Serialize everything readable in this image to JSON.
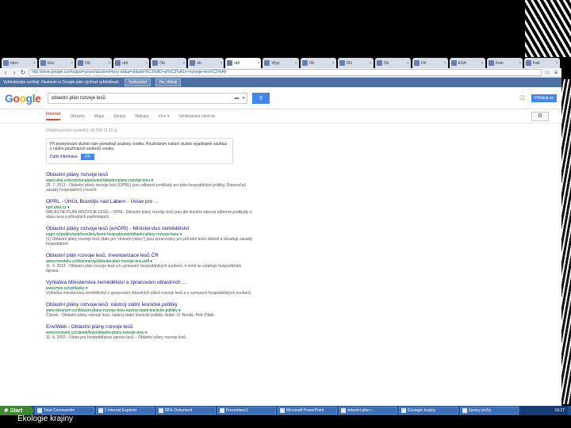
{
  "browser": {
    "tabs": [
      {
        "label": "Iden"
      },
      {
        "label": "Eko"
      },
      {
        "label": "Ob"
      },
      {
        "label": "obl"
      },
      {
        "label": "Ob"
      },
      {
        "label": "ob"
      },
      {
        "label": "obl"
      },
      {
        "label": "Wyp"
      },
      {
        "label": "Ob"
      },
      {
        "label": "DG"
      },
      {
        "label": "Ob"
      },
      {
        "label": "Ob"
      },
      {
        "label": "ESA"
      },
      {
        "label": "Feer"
      },
      {
        "label": "Fab"
      }
    ],
    "url": "http://www.google.cz/#output=search&sclient=psy-ab&q=oblastn%C3%AD+pl%C3%A1n+rozvoje+les%C5%AF"
  },
  "notice_bar": {
    "text": "Vyhledávejte rychleji. Nastavte si Google jako výchozí vyhledávač.",
    "confirm": "Vyzkoušet",
    "dismiss": "Ne, děkuji"
  },
  "google": {
    "logo": [
      "G",
      "o",
      "o",
      "g",
      "l",
      "e"
    ],
    "query": "oblastní plán rozvoje lesů",
    "search_icon": "search-icon",
    "signin": "Přihlásit se",
    "nav": [
      "Internet",
      "Obrázky",
      "Mapy",
      "Zprávy",
      "Nákupy",
      "Více ▾",
      "Vyhledávací nástroje"
    ],
    "stats": "Přibližný počet výsledků: 43 500 (0,26 s)",
    "cookie": {
      "text": "Při poskytování služeb nám pomáhají soubory cookie. Používáním našich služeb vyjadřujete souhlas s naším používáním souborů cookie.",
      "more": "Další informace",
      "ok": "OK"
    },
    "results": [
      {
        "title": "Oblastní plány rozvoje lesů",
        "url": "www.uhul.cz/lesnicke-planovani/oblastni-plany-rozvoje-lesu ▾",
        "snippet": "25. 7. 2011 - Oblastní plány rozvoje lesů (OPRL) jsou odborné podklady pro plán hospodářské politiky. Doporučují zásady hospodaření v lesích."
      },
      {
        "title": "OPRL - ÚHÚL Brandýs nad Labem - Ústav pro ...",
        "url": "oprl.uhul.cz ▾",
        "snippet": "OBLASTNÍ PLÁN ROZVOJE LESŮ – OPRL. Oblastní plány rozvoje lesů jsou dle lesního zákona odborné podklady o stavu lesa a přírodních podmínkách."
      },
      {
        "title": "Oblastní plány rozvoje lesů (eAGRI) - Ministerstvo zemědělství",
        "url": "eagri.cz/public/web/mze/lesy/lesni-hospodarstvi/oblastni-plany-rozvoje-lesu/ ▾",
        "snippet": "(1) Oblastní plány rozvoje lesů (dále jen \"oblastní plány\") jsou zpracovány pro přírodní lesní oblasti a obsahují zásady hospodaření."
      },
      {
        "title": "Oblastní plán rozvoje lesů. Inventarizace lesů ČR",
        "url": "www.mendelu.cz/dokumenty/oblastni-plan-rozvoje-lesu.pdf ▾",
        "snippet": "11. 4. 2012 - Oblastní plán rozvoje lesů a k vymezení hospodářských souborů, k nimž se vztahuje hospodářská úprava."
      },
      {
        "title": "Vyhláška Ministerstva zemědělství o zpracování oblastních ...",
        "url": "www.mze.cz/vyhlasky ▾",
        "snippet": "Vyhláška ministerstva zemědělství o zpracování oblastních plánů rozvoje lesů a o vymezení hospodářských souborů."
      },
      {
        "title": "Oblastní plány rozvoje lesů: nástroj státní lesnické politiky",
        "url": "www.silvarium.cz/oblastni-plany-rozvoje-lesu-nastroj-statni-lesnicke-politiky ▾",
        "snippet": "Článek - Oblastní plány rozvoje lesů, nástroj státní lesnické politiky. Autor: Vl. Novák, Petr Zídek."
      },
      {
        "title": "EnviWeb - Oblastní plány rozvoje lesů",
        "url": "www.enviweb.cz/clanek/lesy/oblastni-plany-rozvoje-lesu ▾",
        "snippet": "11. 4. 2002 - Ústav pro hospodářskou úpravu lesů – Oblastní plány rozvoje lesů."
      }
    ]
  },
  "taskbar": {
    "start": "Start",
    "items": [
      {
        "label": "Total Commander"
      },
      {
        "label": "2 Internet Explorer"
      },
      {
        "label": "86% Dokument"
      },
      {
        "label": "Prezentace1"
      },
      {
        "label": "Microsoft PowerPoint"
      },
      {
        "label": "oblastní plán r..."
      },
      {
        "label": "Ekologie krajiny"
      },
      {
        "label": "Zprávy počty"
      }
    ],
    "clock": "16:27"
  },
  "slide_footer": "Ekologie krajiny",
  "colors": {
    "accent": "#4285f4",
    "link": "#1a0dab",
    "url": "#006621",
    "taskbar": "#1f4f8f"
  }
}
